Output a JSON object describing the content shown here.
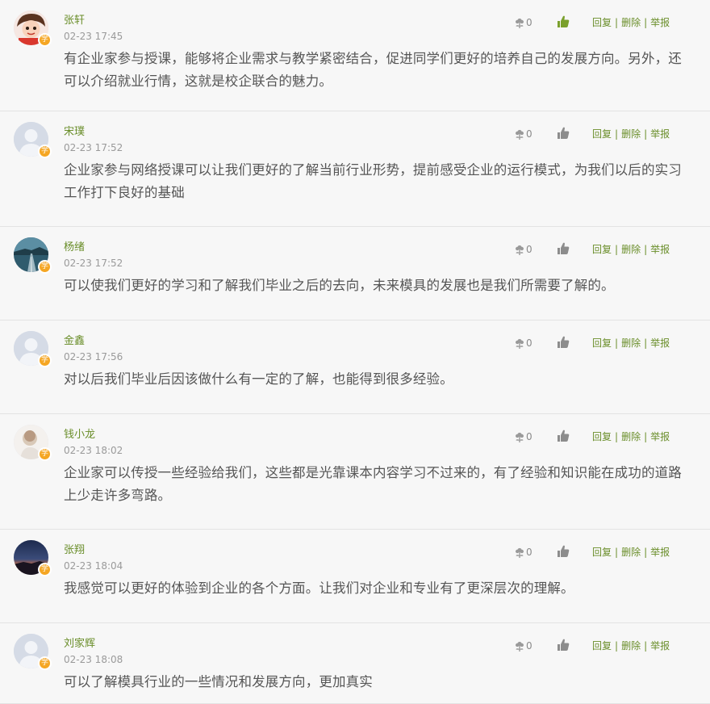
{
  "colors": {
    "accent": "#6a8e2a",
    "badge": "#f5a623",
    "like_active": "#7aa02c",
    "like_inactive": "#8c8c8c"
  },
  "labels": {
    "reply": "回复",
    "delete": "删除",
    "report": "举报",
    "separator": "|",
    "badge": "学"
  },
  "comments": [
    {
      "name": "张轩",
      "time": "02-23 17:45",
      "content": "有企业家参与授课，能够将企业需求与教学紧密结合，促进同学们更好的培养自己的发展方向。另外，还可以介绍就业行情，这就是校企联合的魅力。",
      "flowers": "0",
      "liked": true,
      "avatar": "cartoon-avatar"
    },
    {
      "name": "宋璞",
      "time": "02-23 17:52",
      "content": "企业家参与网络授课可以让我们更好的了解当前行业形势，提前感受企业的运行模式，为我们以后的实习工作打下良好的基础",
      "flowers": "0",
      "liked": false,
      "avatar": "default-avatar"
    },
    {
      "name": "杨绪",
      "time": "02-23 17:52",
      "content": "可以使我们更好的学习和了解我们毕业之后的去向，未来模具的发展也是我们所需要了解的。",
      "flowers": "0",
      "liked": false,
      "avatar": "road-photo-avatar"
    },
    {
      "name": "金鑫",
      "time": "02-23 17:56",
      "content": "对以后我们毕业后因该做什么有一定的了解，也能得到很多经验。",
      "flowers": "0",
      "liked": false,
      "avatar": "default-avatar"
    },
    {
      "name": "钱小龙",
      "time": "02-23 18:02",
      "content": "企业家可以传授一些经验给我们，这些都是光靠课本内容学习不过来的，有了经验和知识能在成功的道路上少走许多弯路。",
      "flowers": "0",
      "liked": false,
      "avatar": "light-photo-avatar"
    },
    {
      "name": "张翔",
      "time": "02-23 18:04",
      "content": "我感觉可以更好的体验到企业的各个方面。让我们对企业和专业有了更深层次的理解。",
      "flowers": "0",
      "liked": false,
      "avatar": "sunset-photo-avatar"
    },
    {
      "name": "刘家辉",
      "time": "02-23 18:08",
      "content": "可以了解模具行业的一些情况和发展方向，更加真实",
      "flowers": "0",
      "liked": false,
      "avatar": "default-avatar"
    }
  ]
}
